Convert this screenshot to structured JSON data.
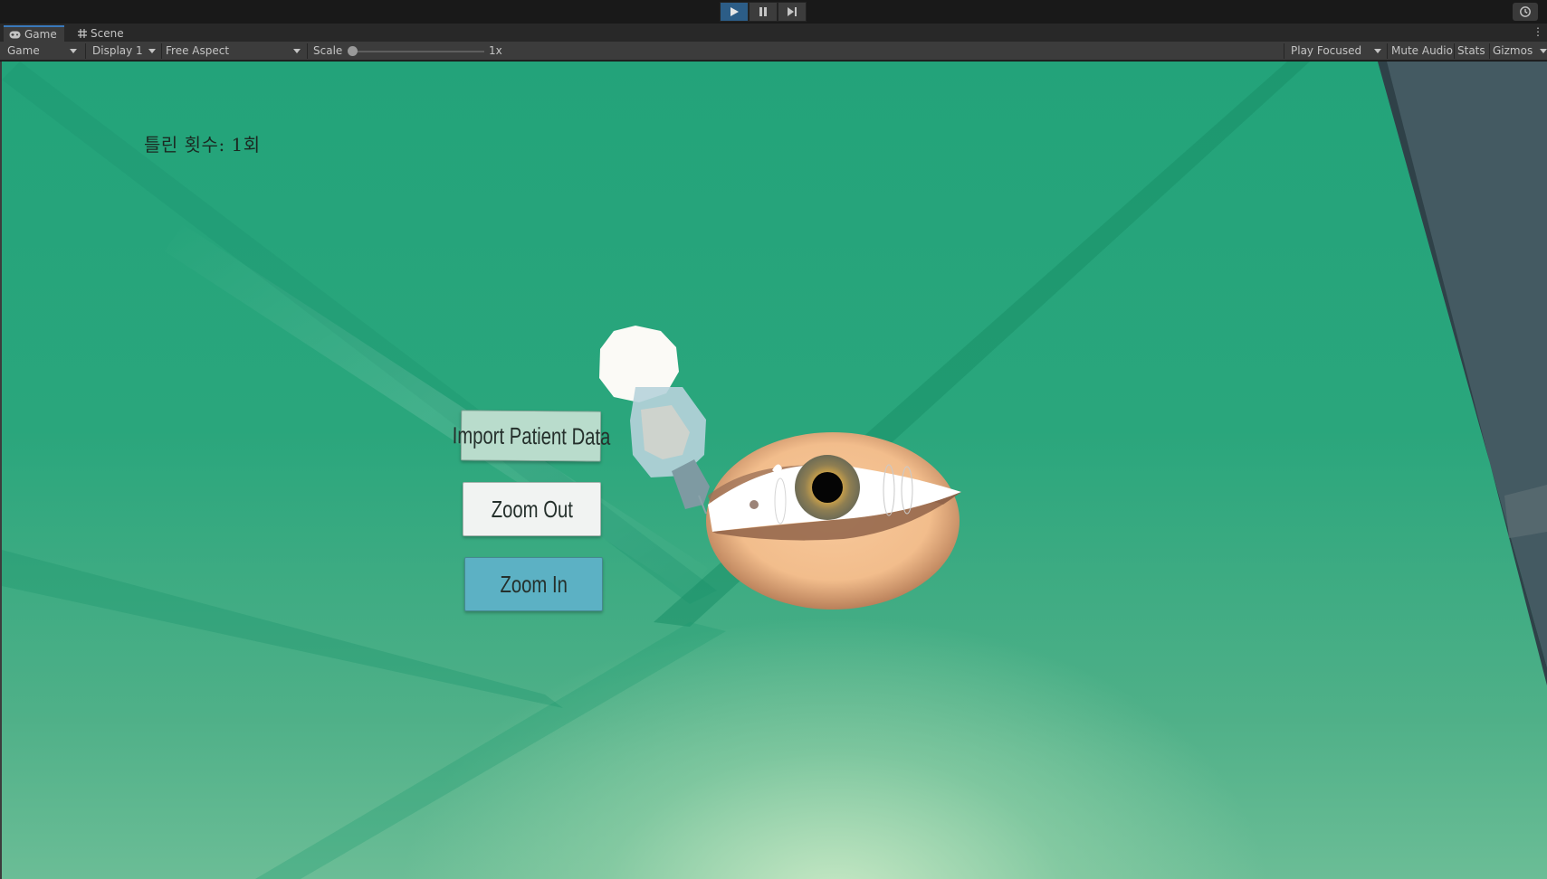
{
  "window": {
    "tabs": [
      {
        "label": "Game",
        "icon": "gamepad-icon",
        "active": true
      },
      {
        "label": "Scene",
        "icon": "grid-icon",
        "active": false
      }
    ],
    "accent_color": "#3a79bb"
  },
  "playbar": {
    "play_icon": "play-icon",
    "pause_icon": "pause-icon",
    "step_icon": "step-icon",
    "history_icon": "history-icon",
    "play_active": true
  },
  "toolbar": {
    "view_mode": "Game",
    "display": "Display 1",
    "aspect": "Free Aspect",
    "scale_label": "Scale",
    "scale_value": "1x",
    "play_mode": "Play Focused",
    "mute_audio": "Mute Audio",
    "stats": "Stats",
    "gizmos": "Gizmos"
  },
  "game": {
    "counter_text": "틀린 횟수: 1회",
    "buttons": {
      "import": "Import Patient Data",
      "zoom_out": "Zoom Out",
      "zoom_in": "Zoom In"
    },
    "colors": {
      "background": "#23a37a",
      "import_button": "#b9dccc",
      "zoom_out_button": "#f1f3f2",
      "zoom_in_button": "#5cb1c4",
      "skin": "#f5c394"
    }
  }
}
